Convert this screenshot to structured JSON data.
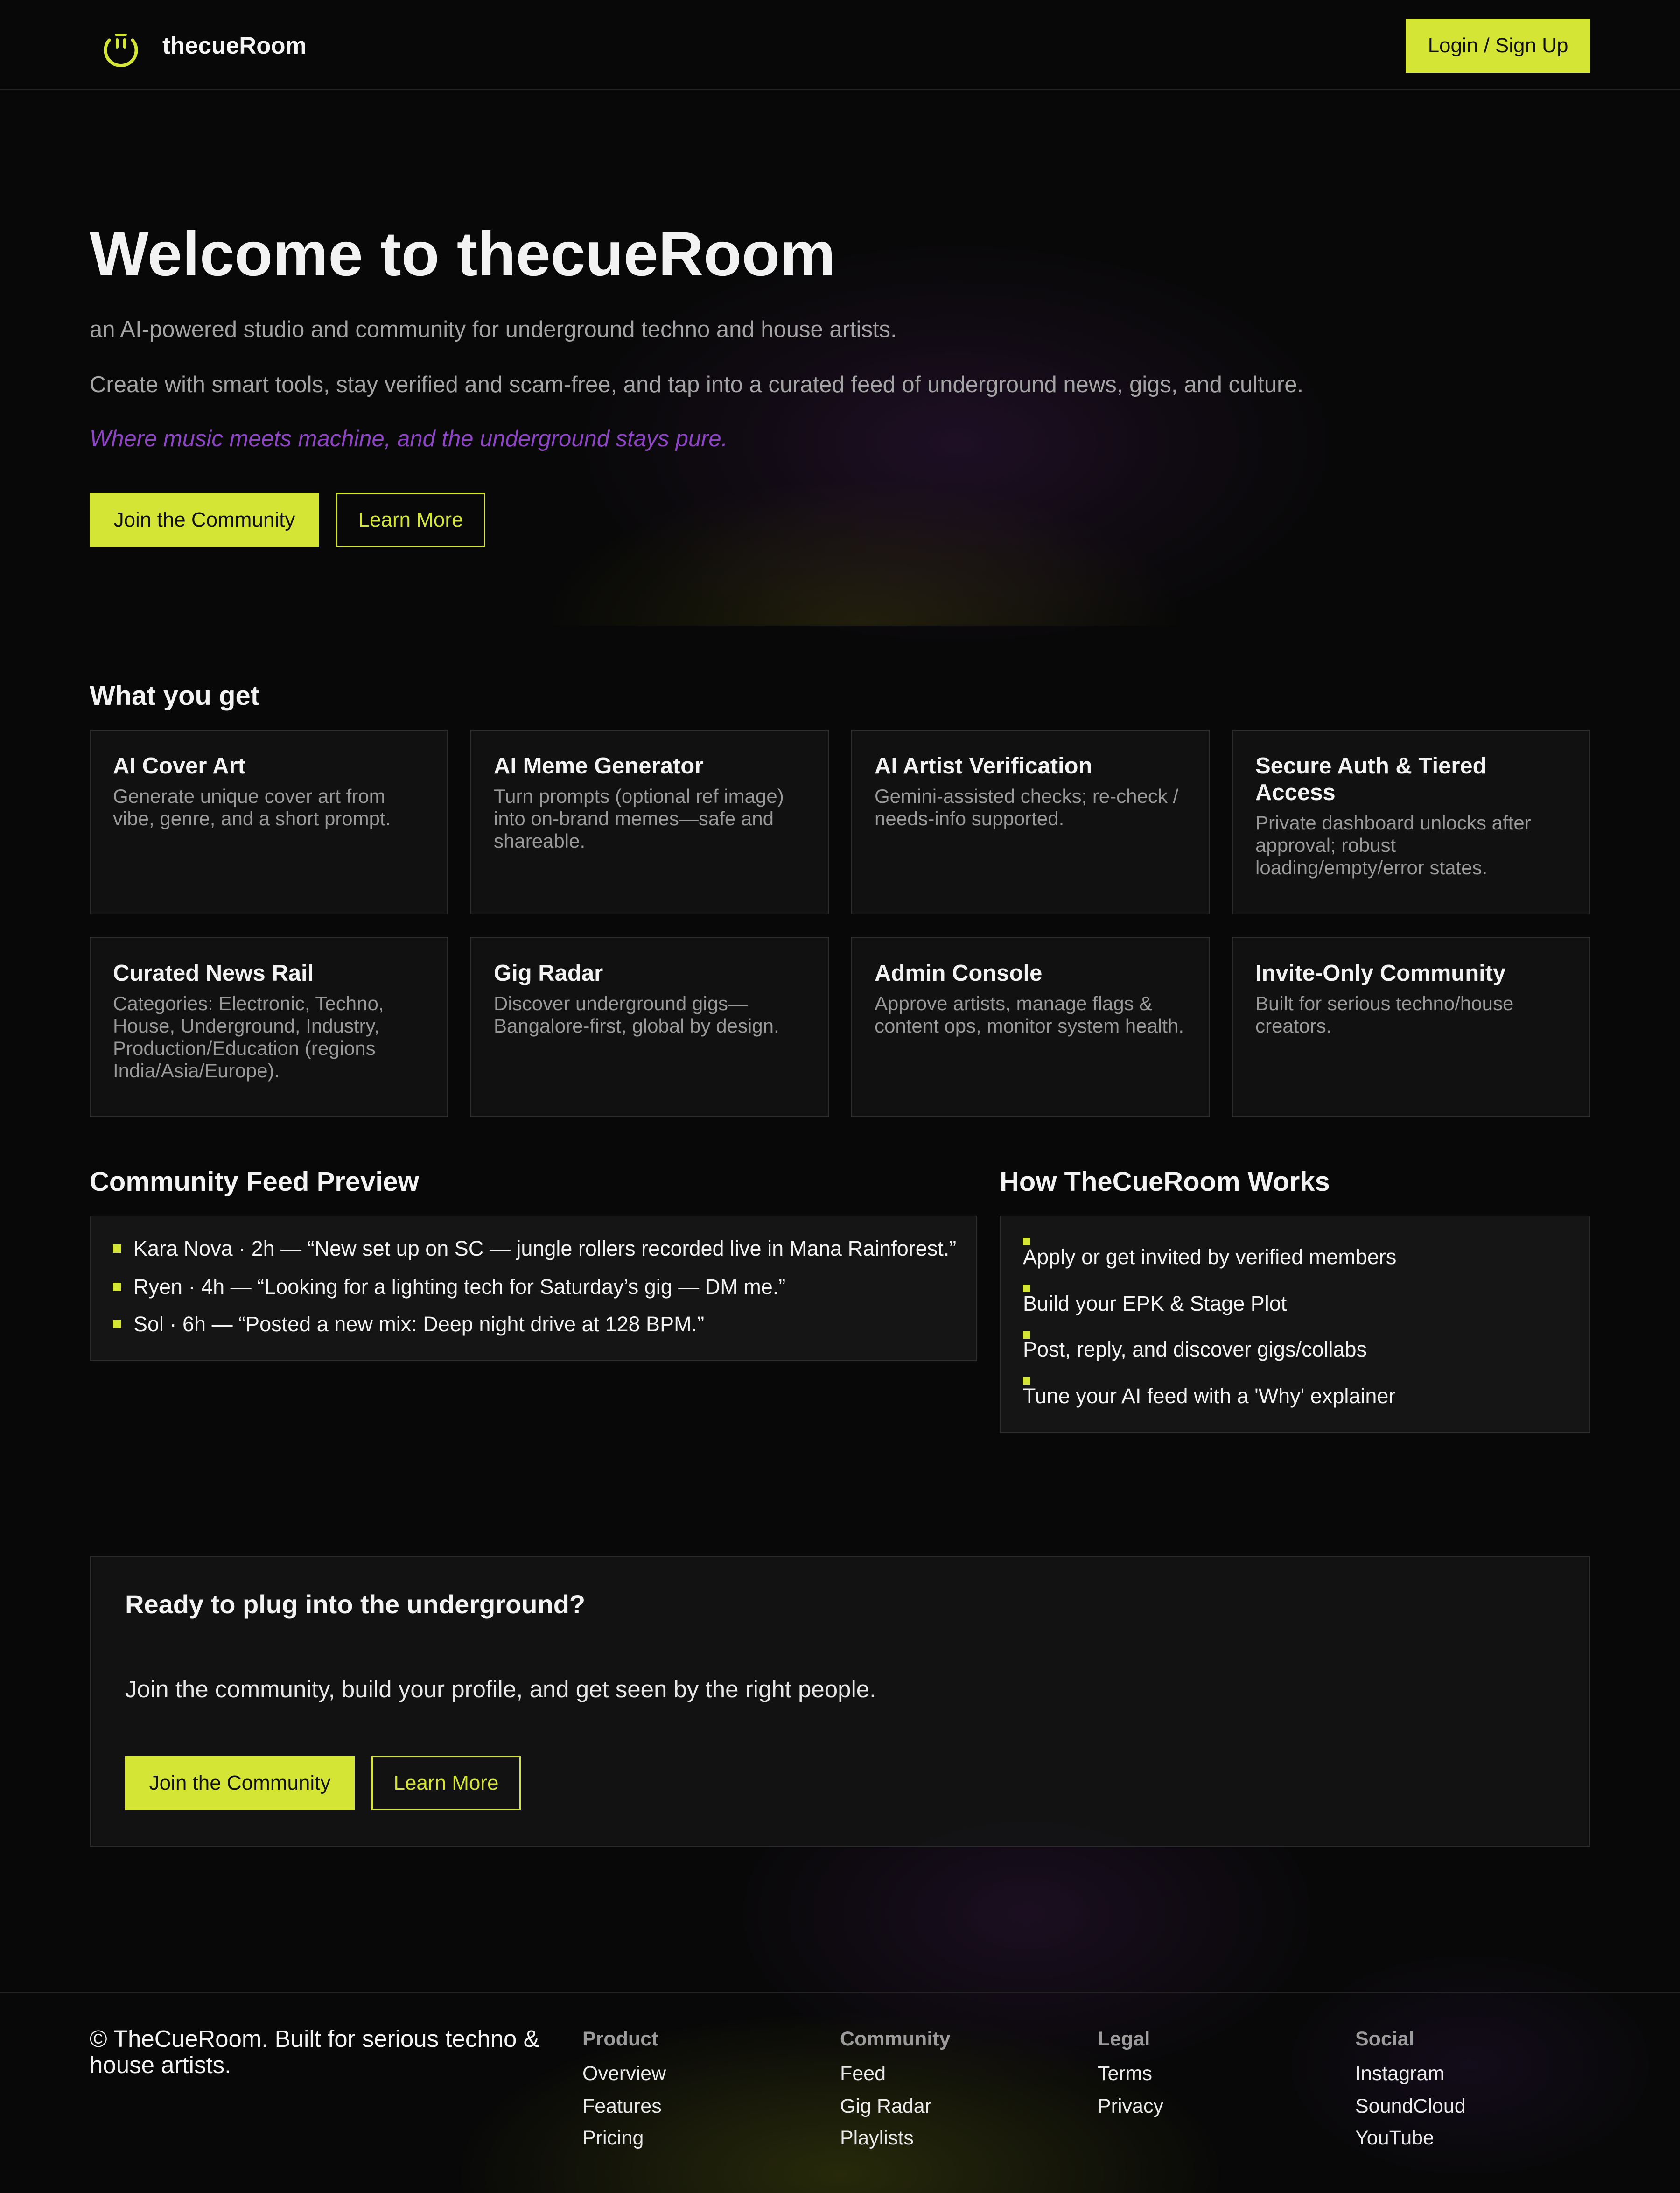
{
  "header": {
    "brand": "thecueRoom",
    "login_label": "Login / Sign Up"
  },
  "hero": {
    "title": "Welcome to thecueRoom",
    "subtitle": "an AI-powered studio and community for underground techno and house artists.",
    "description": "Create with smart tools, stay verified and scam-free, and tap into a curated feed of underground news, gigs, and culture.",
    "tagline": "Where music meets machine, and the underground stays pure.",
    "primary_label": "Join the Community",
    "secondary_label": "Learn More"
  },
  "features": {
    "heading": "What you get",
    "items": [
      {
        "title": "AI Cover Art",
        "desc": "Generate unique cover art from vibe, genre, and a short prompt."
      },
      {
        "title": "AI Meme Generator",
        "desc": "Turn prompts (optional ref image) into on-brand memes—safe and shareable."
      },
      {
        "title": "AI Artist Verification",
        "desc": "Gemini-assisted checks; re-check / needs-info supported."
      },
      {
        "title": "Secure Auth & Tiered Access",
        "desc": "Private dashboard unlocks after approval; robust loading/empty/error states."
      },
      {
        "title": "Curated News Rail",
        "desc": "Categories: Electronic, Techno, House, Underground, Industry, Production/Education (regions India/Asia/Europe)."
      },
      {
        "title": "Gig Radar",
        "desc": "Discover underground gigs—Bangalore-first, global by design."
      },
      {
        "title": "Admin Console",
        "desc": "Approve artists, manage flags & content ops, monitor system health."
      },
      {
        "title": "Invite-Only Community",
        "desc": "Built for serious techno/house creators."
      }
    ]
  },
  "feed": {
    "heading": "Community Feed Preview",
    "items": [
      "Kara Nova · 2h — “New set up on SC — jungle rollers recorded live in Mana Rainforest.”",
      "Ryen · 4h — “Looking for a lighting tech for Saturday’s gig — DM me.”",
      "Sol · 6h — “Posted a new mix: Deep night drive at 128 BPM.”"
    ]
  },
  "how": {
    "heading": "How TheCueRoom Works",
    "steps": [
      "Apply or get invited by verified members",
      "Build your EPK & Stage Plot",
      "Post, reply, and discover gigs/collabs",
      "Tune your AI feed with a 'Why' explainer"
    ]
  },
  "cta": {
    "title": "Ready to plug into the underground?",
    "text": "Join the community, build your profile, and get seen by the right people.",
    "primary_label": "Join the Community",
    "secondary_label": "Learn More"
  },
  "footer": {
    "copyright": "© TheCueRoom. Built for serious techno & house artists.",
    "columns": [
      {
        "title": "Product",
        "links": [
          "Overview",
          "Features",
          "Pricing"
        ]
      },
      {
        "title": "Community",
        "links": [
          "Feed",
          "Gig Radar",
          "Playlists"
        ]
      },
      {
        "title": "Legal",
        "links": [
          "Terms",
          "Privacy"
        ]
      },
      {
        "title": "Social",
        "links": [
          "Instagram",
          "SoundCloud",
          "YouTube"
        ]
      }
    ]
  },
  "colors": {
    "accent": "#d4e535",
    "tagline": "#8e45c5",
    "background": "#080808",
    "card": "#111111"
  },
  "icons": {
    "logo": "smile-logo-icon",
    "bullet": "square-bullet-icon"
  }
}
